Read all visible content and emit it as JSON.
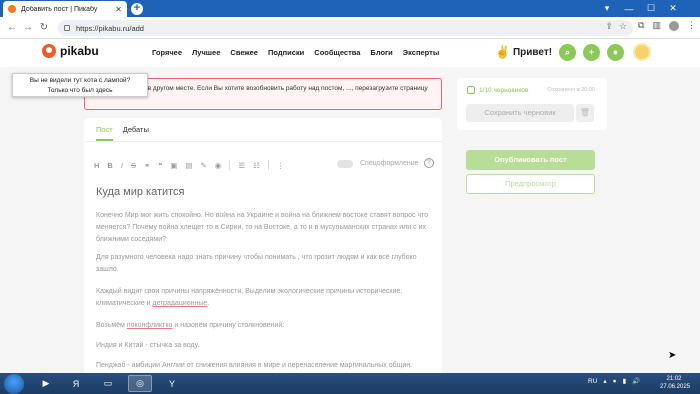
{
  "browser": {
    "tab_title": "Добавить пост | Пикабу",
    "url": "https://pikabu.ru/add"
  },
  "header": {
    "logo": "pikabu",
    "nav": [
      "Горячее",
      "Лучшее",
      "Свежее",
      "Подписки",
      "Сообщества",
      "Блоги",
      "Эксперты"
    ],
    "greeting": "Привет!"
  },
  "tooltip": {
    "line1": "Вы не видели тут кота с лампой?",
    "line2": "Только что был здесь"
  },
  "alert": {
    "text": "...ирование поста в другом месте. Если Вы хотите возобновить работу над постом, ..., перезагрузите страницу"
  },
  "editor": {
    "tabs": [
      "Пост",
      "Дебаты"
    ],
    "toolbar_label": "Спецоформление",
    "post_title": "Куда мир катится",
    "paragraphs": [
      "Конечно Мир мог жить спокойно. Но война на Украине и война на ближнем востоке ставят вопрос что меняется? Почему война хлещет то в Сирии, то на Востоке, а то и в мусульманских странах или с их ближними соседями?",
      "Для разумного человека надо знать причину чтобы понимать , что грозит людям и как всё глубоко зашло.",
      "Каждый видит свои причины напряжённости. Выделим экологические причины исторические, климатические и",
      "Возьмём",
      "Индия и Китай - стычка за воду.",
      "Пенджаб - амбиции Англии от снижения влияния в мире и перенаселение маргинальных общин."
    ],
    "link1": "деградационные",
    "link2": "поконфликтко",
    "para3_end": ".",
    "para4_end": "и назовём причину столкновений:"
  },
  "sidebar": {
    "drafts": "1/10 черновиков",
    "saved": "Сохранено в 20:00",
    "save_draft": "Сохранить черновик",
    "publish": "Опубликовать пост",
    "preview": "Предпросмотр"
  },
  "taskbar": {
    "lang": "RU",
    "time": "21:02",
    "date": "27.06.2025"
  }
}
